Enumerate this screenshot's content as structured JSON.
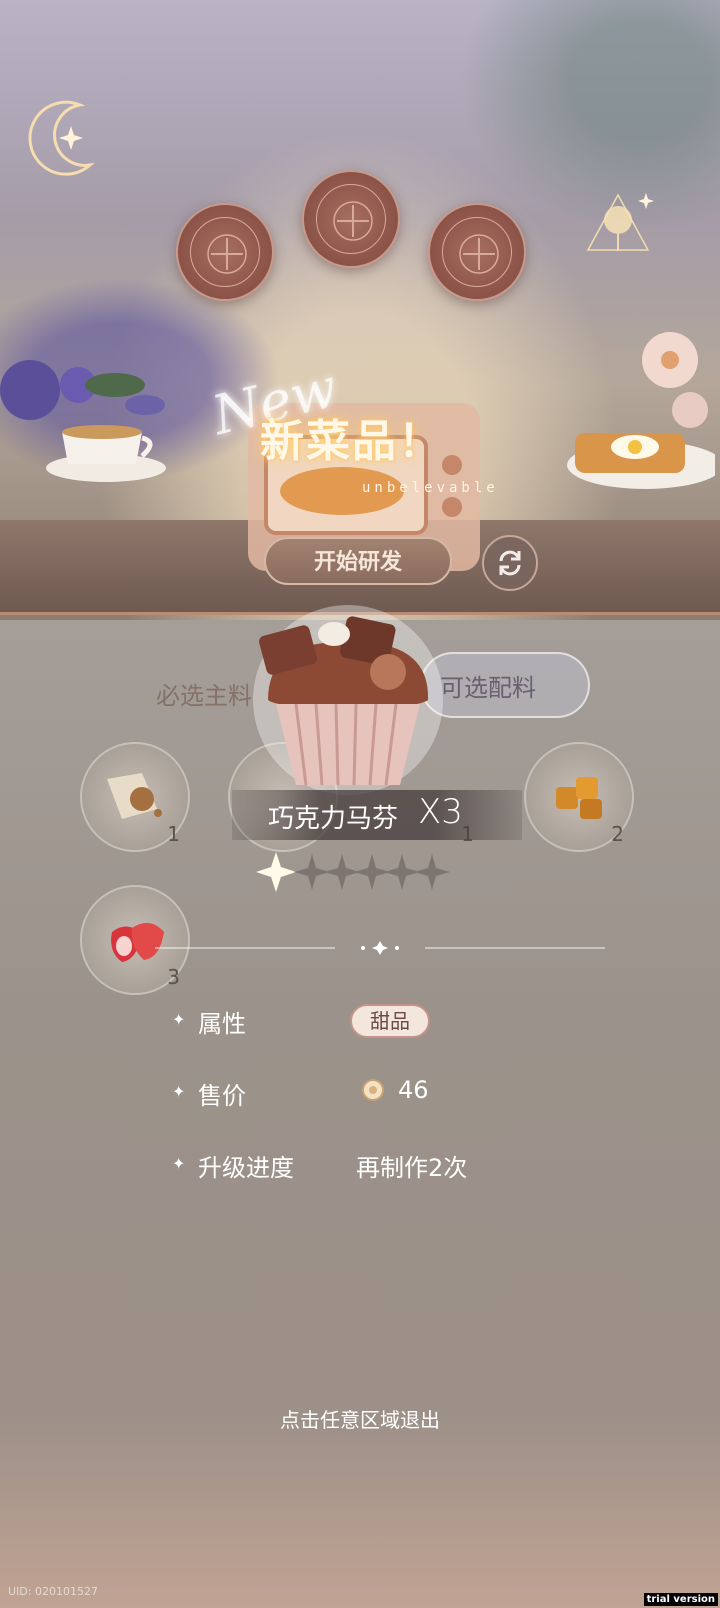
{
  "colors": {
    "accent_glow": "#ffd57a",
    "slot_brown": "#8b5348",
    "tag_bg": "#f3e6dc",
    "panel": "#9b928b"
  },
  "scene": {
    "moon_icon": "crescent-moon-icon",
    "rose_badge_icon": "rose-bell-jar-icon",
    "slots": [
      {
        "icon": "plus-icon"
      },
      {
        "icon": "plus-icon"
      },
      {
        "icon": "plus-icon"
      }
    ]
  },
  "banner": {
    "script_text": "New",
    "title": "新菜品！",
    "subtitle": "unbelevable"
  },
  "actions": {
    "start_label": "开始研发",
    "refresh_icon": "refresh-icon"
  },
  "tabs": {
    "main": "必选主料",
    "optional": "可选配料"
  },
  "ingredients": [
    {
      "name": "grain-sack",
      "count": "1"
    },
    {
      "name": "hidden",
      "count": "1"
    },
    {
      "name": "caramel",
      "count": "2"
    },
    {
      "name": "strawberry",
      "count": "3"
    }
  ],
  "dish": {
    "name": "巧克力马芬",
    "count": "X3",
    "stars_filled": 1,
    "stars_total": 6
  },
  "attributes": {
    "attr_label": "属性",
    "attr_value": "甜品",
    "price_label": "售价",
    "price_value": "46",
    "progress_label": "升级进度",
    "progress_value": "再制作2次"
  },
  "footer": {
    "exit_hint": "点击任意区域退出",
    "uid": "UID: 020101527",
    "trial": "trial version"
  }
}
